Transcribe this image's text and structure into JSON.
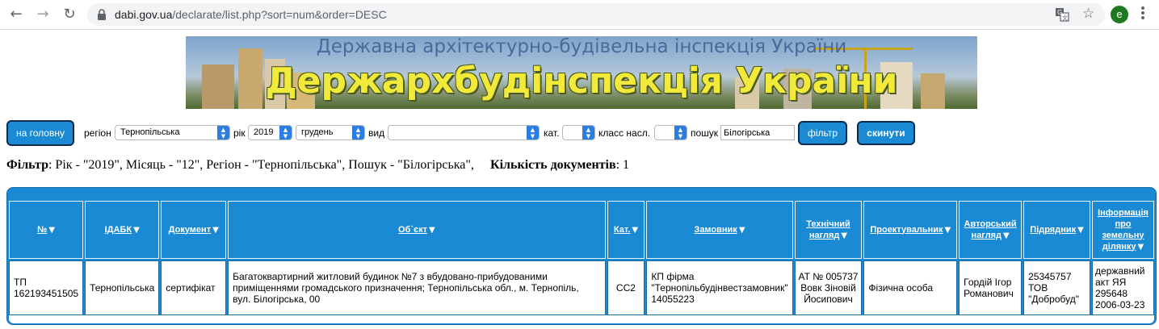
{
  "browser": {
    "url_domain": "dabi.gov.ua",
    "url_path": "/declarate/list.php?sort=num&order=DESC",
    "avatar_letter": "e"
  },
  "banner": {
    "subtitle": "Державна архітектурно-будівельна інспекція України",
    "title": "Держархбудінспекція України"
  },
  "controls": {
    "home_button": "на головну",
    "region_label": "регіон",
    "region_value": "Тернопільська",
    "year_label": "рік",
    "year_value": "2019",
    "month_value": "грудень",
    "type_label": "вид",
    "type_value": "",
    "category_label": "кат.",
    "category_value": "",
    "class_label": "класс насл.",
    "class_value": "",
    "search_label": "пошук",
    "search_value": "Білогірська",
    "filter_button": "фільтр",
    "reset_button": "скинути"
  },
  "filter_info": {
    "label": "Фільтр",
    "text": ": Рік - \"2019\", Місяць - \"12\", Регіон - \"Тернопільська\", Пошук - \"Білогірська\",",
    "count_label": "Кількість документів",
    "count_value": ": 1"
  },
  "table": {
    "headers": [
      [
        "№"
      ],
      [
        "ІДАБК"
      ],
      [
        "Документ"
      ],
      [
        "Об`єкт"
      ],
      [
        "Кат."
      ],
      [
        "Замовник"
      ],
      [
        "Технічний",
        "нагляд"
      ],
      [
        "Проектувальник"
      ],
      [
        "Авторський",
        "нагляд"
      ],
      [
        "Підрядник"
      ],
      [
        "Інформація",
        "про",
        "земельну",
        "ділянку"
      ]
    ],
    "row": {
      "num": [
        "ТП",
        "162193451505"
      ],
      "idabk": "Тернопільська",
      "document": "сертифікат",
      "object": [
        "Багатоквартирний житловий будинок №7 з вбудовано-прибудованими",
        "приміщеннями громадського призначення; Тернопільська обл., м. Тернопіль,",
        "вул. Білогірська, 00"
      ],
      "category": "СС2",
      "customer": [
        "КП фірма",
        "\"Тернопільбудінвестзамовник\"",
        "14055223"
      ],
      "tech_supervision": [
        "АТ № 005737",
        "Вовк Зіновій",
        "Йосипович"
      ],
      "designer": "Фізична особа",
      "author_supervision": [
        "Гордій Ігор",
        "Романович"
      ],
      "contractor": [
        "25345757",
        "ТОВ",
        "\"Добробуд\""
      ],
      "land_info": [
        "державний",
        "акт ЯЯ",
        "295648",
        "2006-03-23"
      ]
    }
  },
  "colors": {
    "accent": "#1a8ad4",
    "banner_title": "#f2ea3a"
  }
}
